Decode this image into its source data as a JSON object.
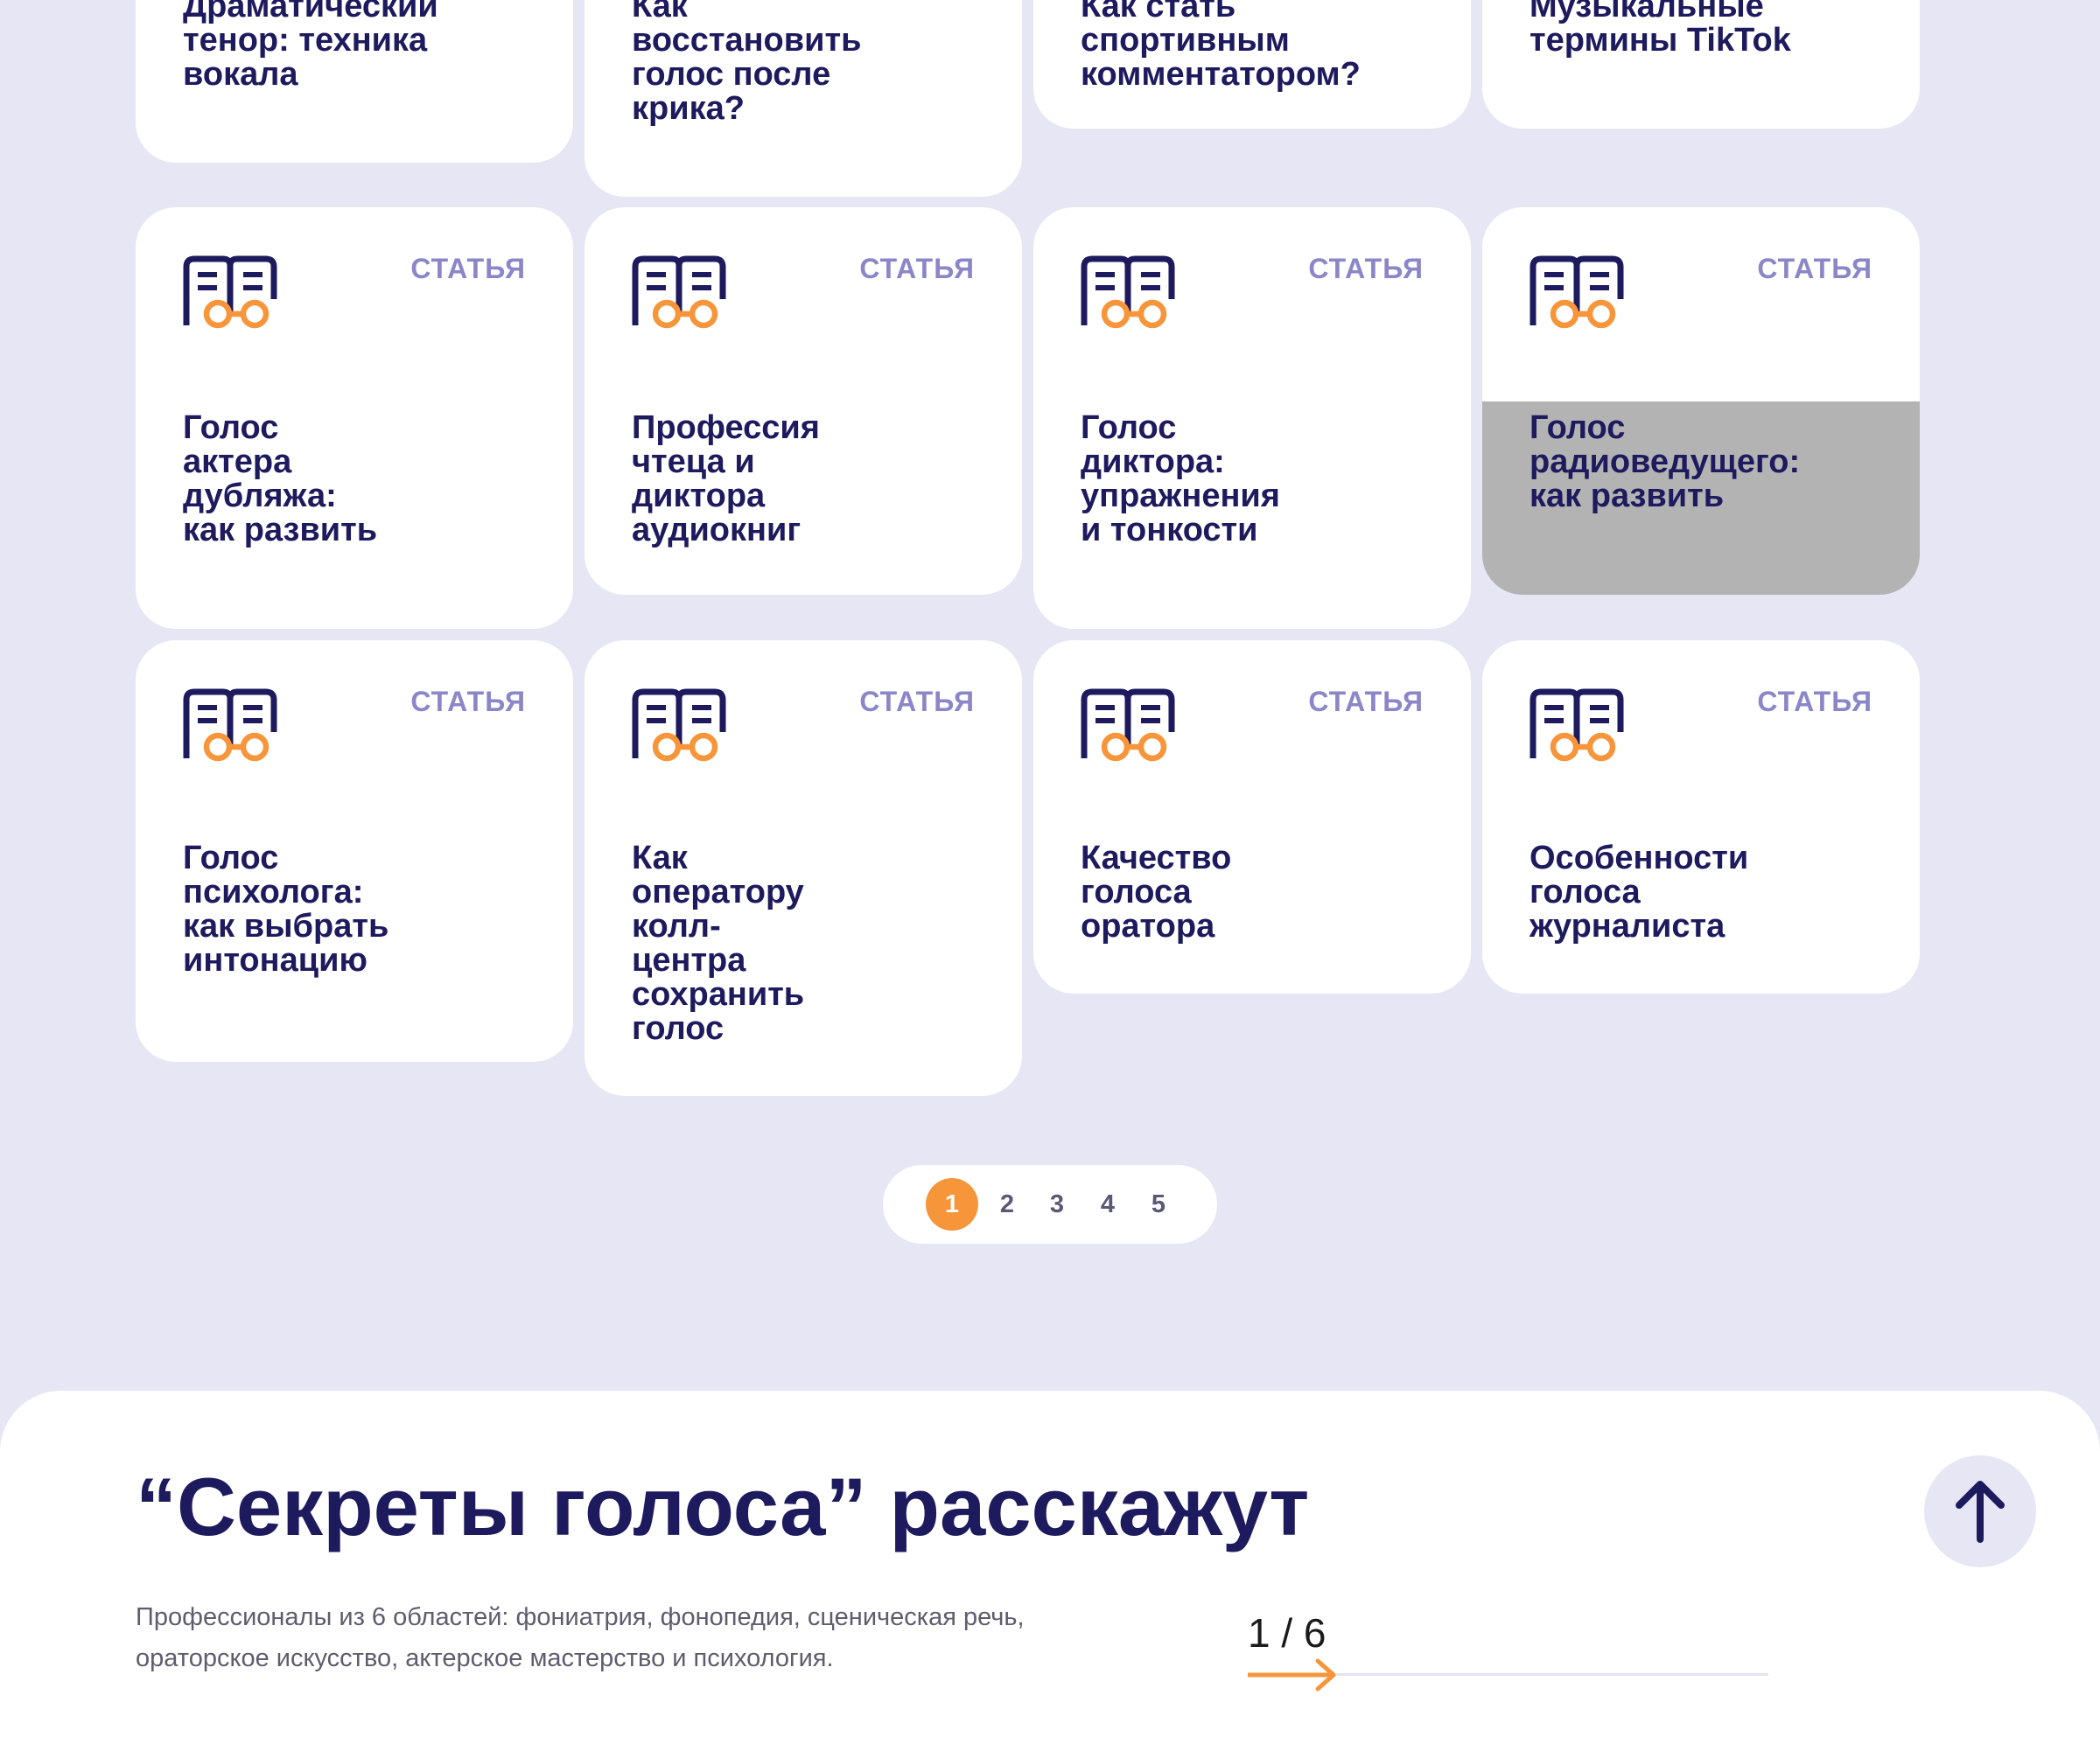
{
  "cards": [
    {
      "title": "Драматический тенор: техника вокала",
      "badge": ""
    },
    {
      "title": "Как восстановить голос после крика?",
      "badge": ""
    },
    {
      "title": "Как стать спортивным комментатором?",
      "badge": ""
    },
    {
      "title": "Музыкальные термины TikTok",
      "badge": ""
    },
    {
      "title": "Голос актера дубляжа: как развить",
      "badge": "СТАТЬЯ"
    },
    {
      "title": "Профессия чтеца и диктора аудиокниг",
      "badge": "СТАТЬЯ"
    },
    {
      "title": "Голос диктора: упражнения и тонкости",
      "badge": "СТАТЬЯ"
    },
    {
      "title": "Голос радиоведущего: как развить",
      "badge": "СТАТЬЯ"
    },
    {
      "title": "Голос психолога: как выбрать интонацию",
      "badge": "СТАТЬЯ"
    },
    {
      "title": "Как оператору колл-центра сохранить голос",
      "badge": "СТАТЬЯ"
    },
    {
      "title": "Качество голоса оратора",
      "badge": "СТАТЬЯ"
    },
    {
      "title": "Особенности голоса журналиста",
      "badge": "СТАТЬЯ"
    }
  ],
  "card_icon": "book-glasses-icon",
  "pagination": {
    "pages": [
      "1",
      "2",
      "3",
      "4",
      "5"
    ],
    "current": "1"
  },
  "section": {
    "heading": "“Секреты голоса” расскажут",
    "description": "Профессионалы из 6 областей: фониатрия, фонопедия, сценическая речь, ораторское искусство, актерское мастерство и психология.",
    "slider_counter": "1 / 6",
    "slider_progress": "1/6",
    "scroll_top_icon": "arrow-up-icon"
  },
  "colors": {
    "page_background": "#e7e6f4",
    "text_primary": "#1e1a5e",
    "accent_orange": "#f7953a",
    "badge_text": "#8b86c8",
    "hover_overlay": "#b3b3b3"
  }
}
